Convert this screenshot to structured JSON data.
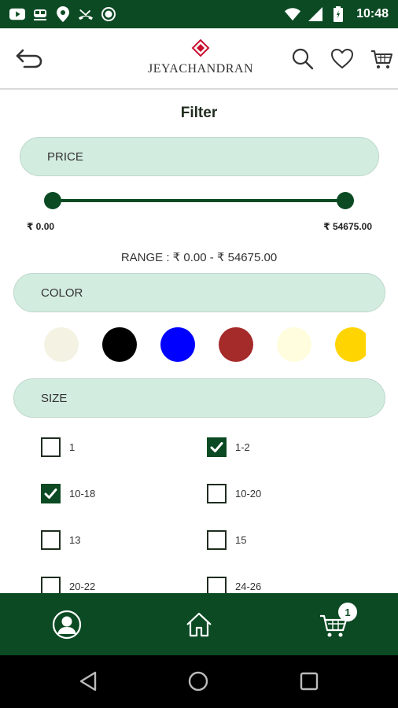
{
  "status_bar": {
    "time": "10:48",
    "icons_left": [
      "youtube-icon",
      "train-icon",
      "location-pin-icon",
      "missed-call-icon",
      "circle-icon"
    ],
    "icons_right": [
      "wifi-icon",
      "signal-icon",
      "battery-icon"
    ]
  },
  "header": {
    "brand": "JEYACHANDRAN",
    "brand_color": "#c8102e"
  },
  "filter": {
    "title": "Filter"
  },
  "price": {
    "label": "PRICE",
    "min_label": "₹ 0.00",
    "max_label": "₹ 54675.00",
    "range_text": "RANGE :  ₹ 0.00 - ₹ 54675.00",
    "selected_min": 0.0,
    "selected_max": 54675.0
  },
  "color": {
    "label": "COLOR",
    "swatches": [
      "#f4f3e3",
      "#000000",
      "#0000ff",
      "#a52a2a",
      "#fffdde",
      "#ffd400"
    ]
  },
  "size": {
    "label": "SIZE",
    "options": [
      {
        "label": "1",
        "checked": false
      },
      {
        "label": "1-2",
        "checked": true
      },
      {
        "label": "10-18",
        "checked": true
      },
      {
        "label": "10-20",
        "checked": false
      },
      {
        "label": "13",
        "checked": false
      },
      {
        "label": "15",
        "checked": false
      },
      {
        "label": "20-22",
        "checked": false
      },
      {
        "label": "24-26",
        "checked": false
      }
    ]
  },
  "bottom_nav": {
    "cart_count": "1",
    "items": [
      "profile-icon",
      "home-icon",
      "cart-icon"
    ]
  },
  "theme": {
    "primary": "#0b4a23",
    "pill_bg": "#d3ece0"
  }
}
